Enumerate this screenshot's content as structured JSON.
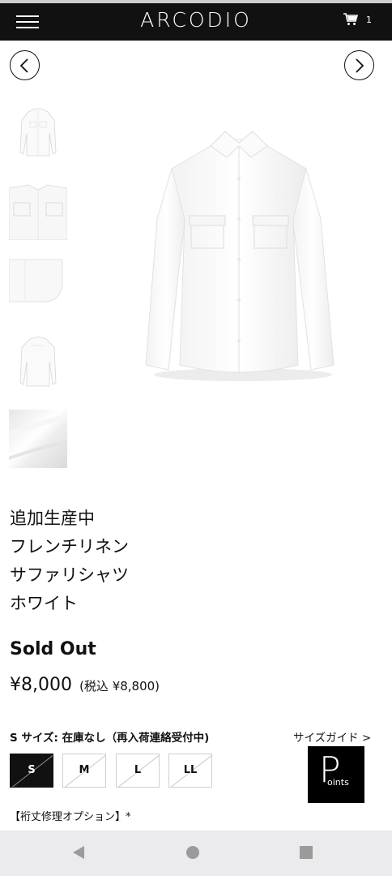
{
  "header": {
    "logo": "ARCODIO",
    "cart_count": "1",
    "menu_icon": "hamburger-icon",
    "cart_icon": "cart-icon"
  },
  "gallery": {
    "prev_icon": "chevron-left-icon",
    "next_icon": "chevron-right-icon",
    "thumbnails": [
      "shirt-front-small",
      "shirt-chest-pockets",
      "shirt-hem",
      "shirt-back",
      "fabric-texture"
    ]
  },
  "product": {
    "title_lines": [
      "追加生産中",
      "フレンチリネン",
      "サファリシャツ",
      "ホワイト"
    ],
    "status": "Sold Out",
    "price": "¥8,000",
    "tax_price": "(税込 ¥8,800)"
  },
  "sizes": {
    "status": "S サイズ: 在庫なし（再入荷連絡受付中)",
    "guide": "サイズガイド >",
    "options": [
      {
        "label": "S",
        "selected": true
      },
      {
        "label": "M",
        "selected": false
      },
      {
        "label": "L",
        "selected": false
      },
      {
        "label": "LL",
        "selected": false
      }
    ]
  },
  "points_logo": {
    "p": "P",
    "text": "oints"
  },
  "repair_option": "【裄丈修理オプション】*",
  "android_nav": {
    "back": "back-icon",
    "home": "home-icon",
    "recent": "recent-apps-icon"
  }
}
